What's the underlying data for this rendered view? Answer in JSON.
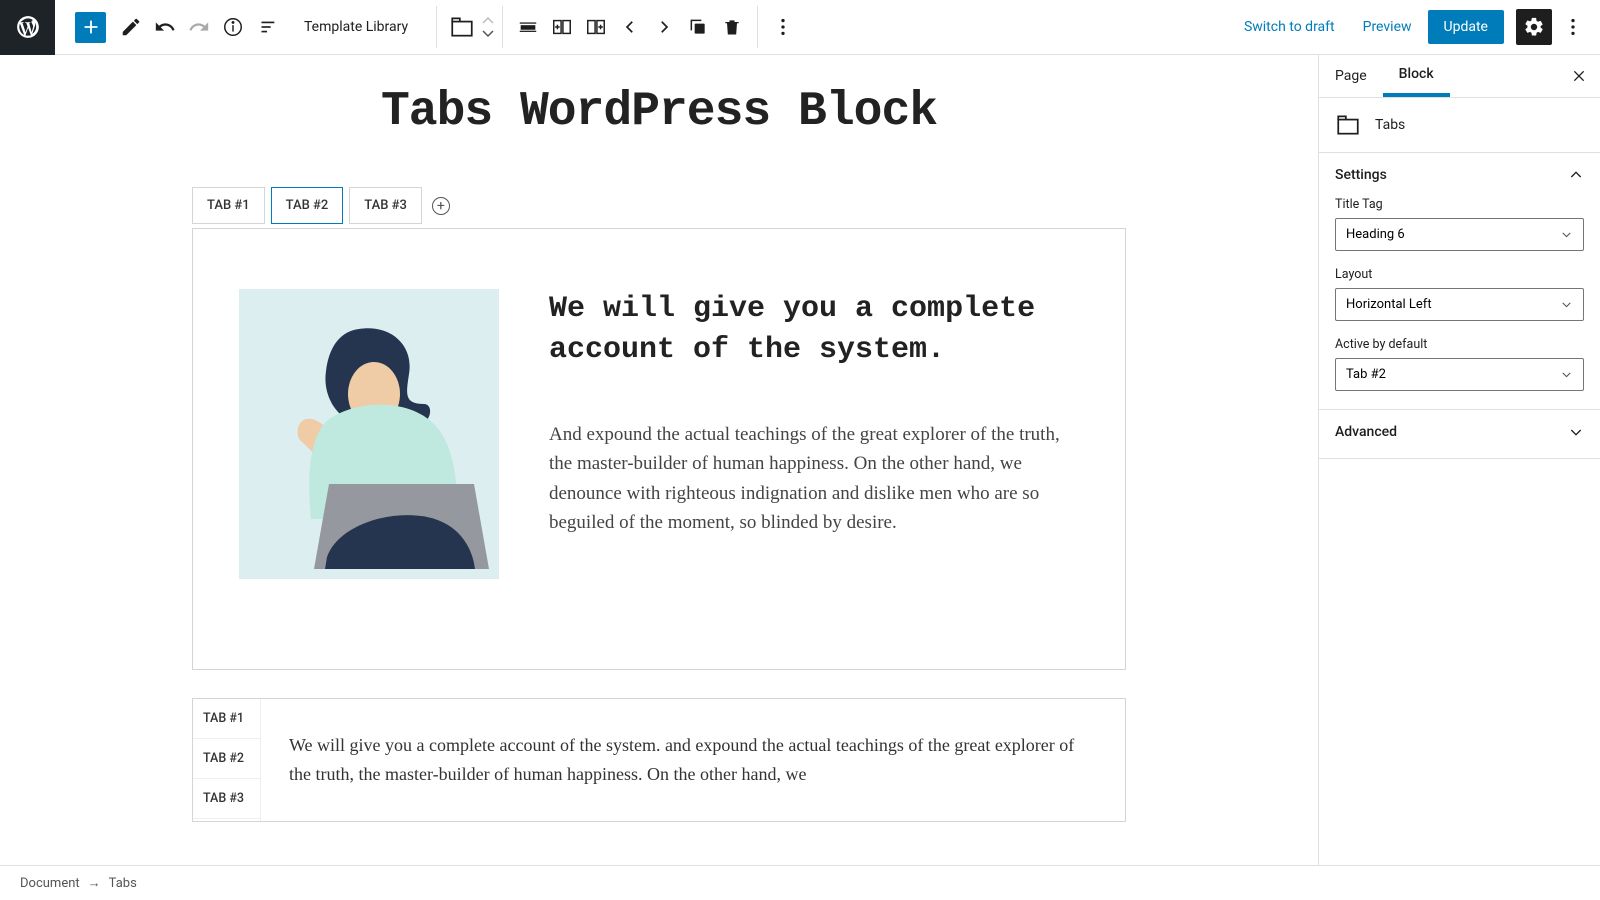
{
  "toolbar": {
    "template_label": "Template Library",
    "switch_draft": "Switch to draft",
    "preview": "Preview",
    "update": "Update"
  },
  "page": {
    "title": "Tabs WordPress Block"
  },
  "block1": {
    "tabs": [
      "TAB #1",
      "TAB #2",
      "TAB #3"
    ],
    "heading": "We will give you a complete account of the system.",
    "body": "And expound the actual teachings of the great explorer of the truth, the master-builder of human happiness. On the other hand, we denounce with righteous indignation and dislike men who are so beguiled of the moment, so blinded by desire."
  },
  "block2": {
    "tabs": [
      "TAB #1",
      "TAB #2",
      "TAB #3"
    ],
    "body": "We will give you a complete account of the system. and expound the  actual teachings of the great explorer of the truth, the master-builder  of human happiness. On the other hand, we"
  },
  "sidebar": {
    "tab_page": "Page",
    "tab_block": "Block",
    "block_name": "Tabs",
    "panel_settings": "Settings",
    "label_title_tag": "Title Tag",
    "value_title_tag": "Heading 6",
    "label_layout": "Layout",
    "value_layout": "Horizontal Left",
    "label_active": "Active by default",
    "value_active": "Tab #2",
    "panel_advanced": "Advanced"
  },
  "breadcrumb": {
    "doc": "Document",
    "arrow": "→",
    "block": "Tabs"
  }
}
